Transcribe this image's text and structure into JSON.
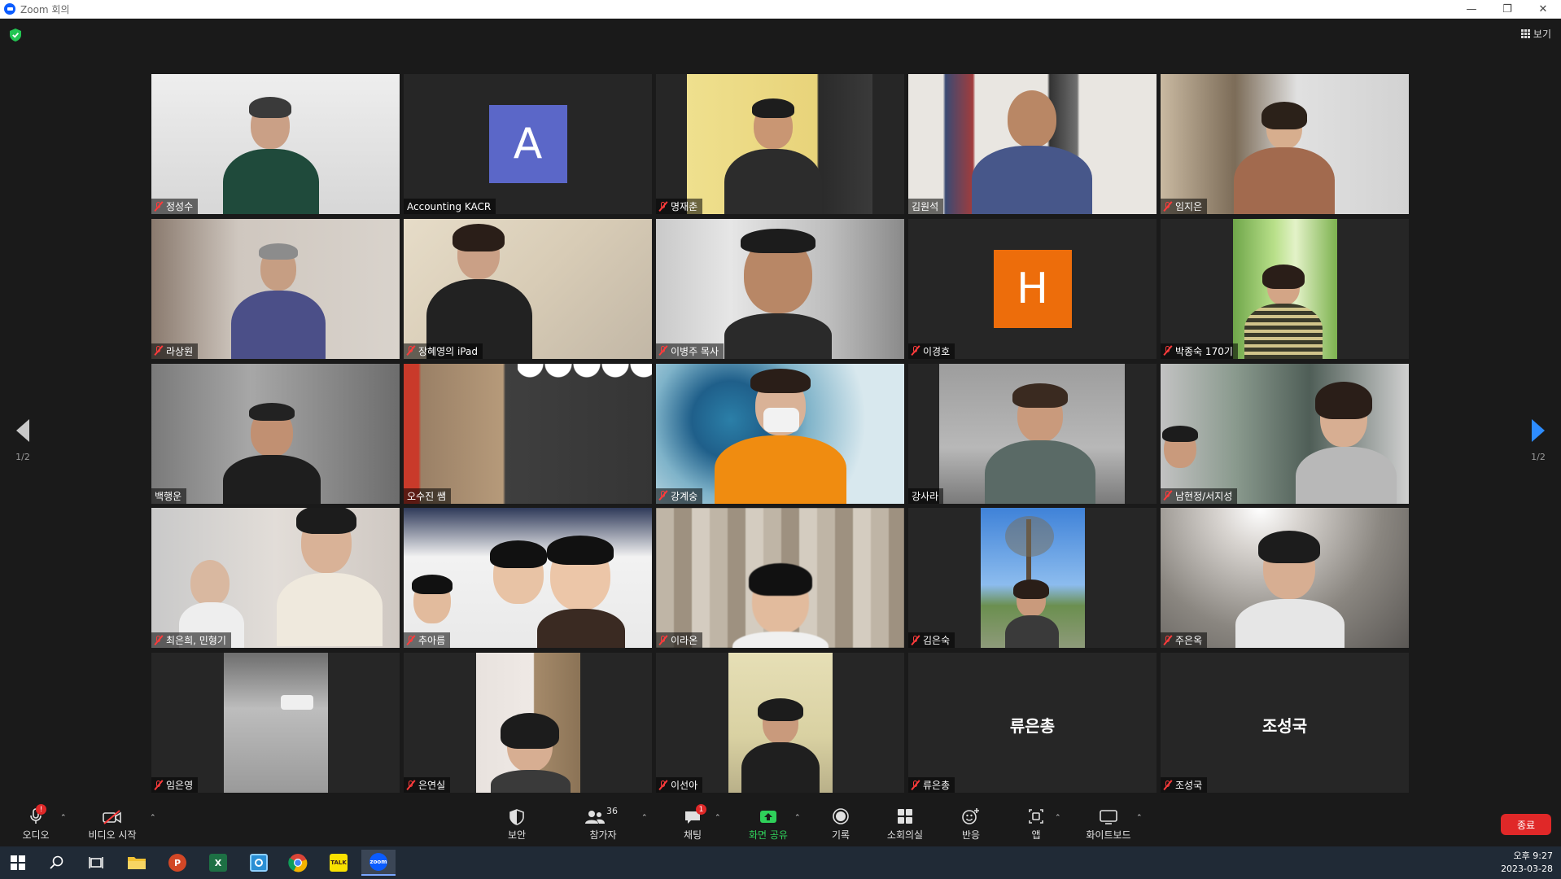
{
  "window": {
    "title": "Zoom 회의"
  },
  "top_bar": {
    "view_label": "보기"
  },
  "pagination": {
    "left": "1/2",
    "right": "1/2"
  },
  "participants": [
    {
      "name": "정성수",
      "muted": true
    },
    {
      "name": "Accounting KACR",
      "muted": false,
      "avatar_letter": "A",
      "avatar_color": "#5b67c8"
    },
    {
      "name": "명재춘",
      "muted": true
    },
    {
      "name": "김원석",
      "muted": false
    },
    {
      "name": "임지은",
      "muted": true
    },
    {
      "name": "라상원",
      "muted": true
    },
    {
      "name": "장혜영의 iPad",
      "muted": true
    },
    {
      "name": "이병주 목사",
      "muted": true
    },
    {
      "name": "이경호",
      "muted": true,
      "avatar_letter": "H",
      "avatar_color": "#ed6d0b"
    },
    {
      "name": "박종숙 170기",
      "muted": true
    },
    {
      "name": "백행운",
      "muted": false
    },
    {
      "name": "오수진 쌤",
      "muted": false,
      "active_speaker": true
    },
    {
      "name": "강계숭",
      "muted": true
    },
    {
      "name": "강사라",
      "muted": false
    },
    {
      "name": "남현정/서지성",
      "muted": true
    },
    {
      "name": "최은희, 민형기",
      "muted": true
    },
    {
      "name": "추아름",
      "muted": true
    },
    {
      "name": "이라온",
      "muted": true
    },
    {
      "name": "김은숙",
      "muted": true
    },
    {
      "name": "주은옥",
      "muted": true
    },
    {
      "name": "임은영",
      "muted": true
    },
    {
      "name": "은연실",
      "muted": true
    },
    {
      "name": "이선아",
      "muted": true
    },
    {
      "name": "류은총",
      "muted": true,
      "video_off_name": "류은총"
    },
    {
      "name": "조성국",
      "muted": true,
      "video_off_name": "조성국"
    }
  ],
  "toolbar": {
    "audio": "오디오",
    "video": "비디오 시작",
    "security": "보안",
    "participants": "참가자",
    "participants_count": "36",
    "chat": "채팅",
    "chat_badge": "1",
    "audio_badge": "!",
    "share": "화면 공유",
    "record": "기록",
    "breakout": "소회의실",
    "reactions": "반응",
    "apps": "앱",
    "whiteboard": "화이트보드",
    "end": "종료"
  },
  "taskbar": {
    "time": "오후 9:27",
    "date": "2023-03-28",
    "kakao_label": "TALK",
    "zoom_label": "zoom",
    "excel_label": "X",
    "ppt_label": "P"
  }
}
